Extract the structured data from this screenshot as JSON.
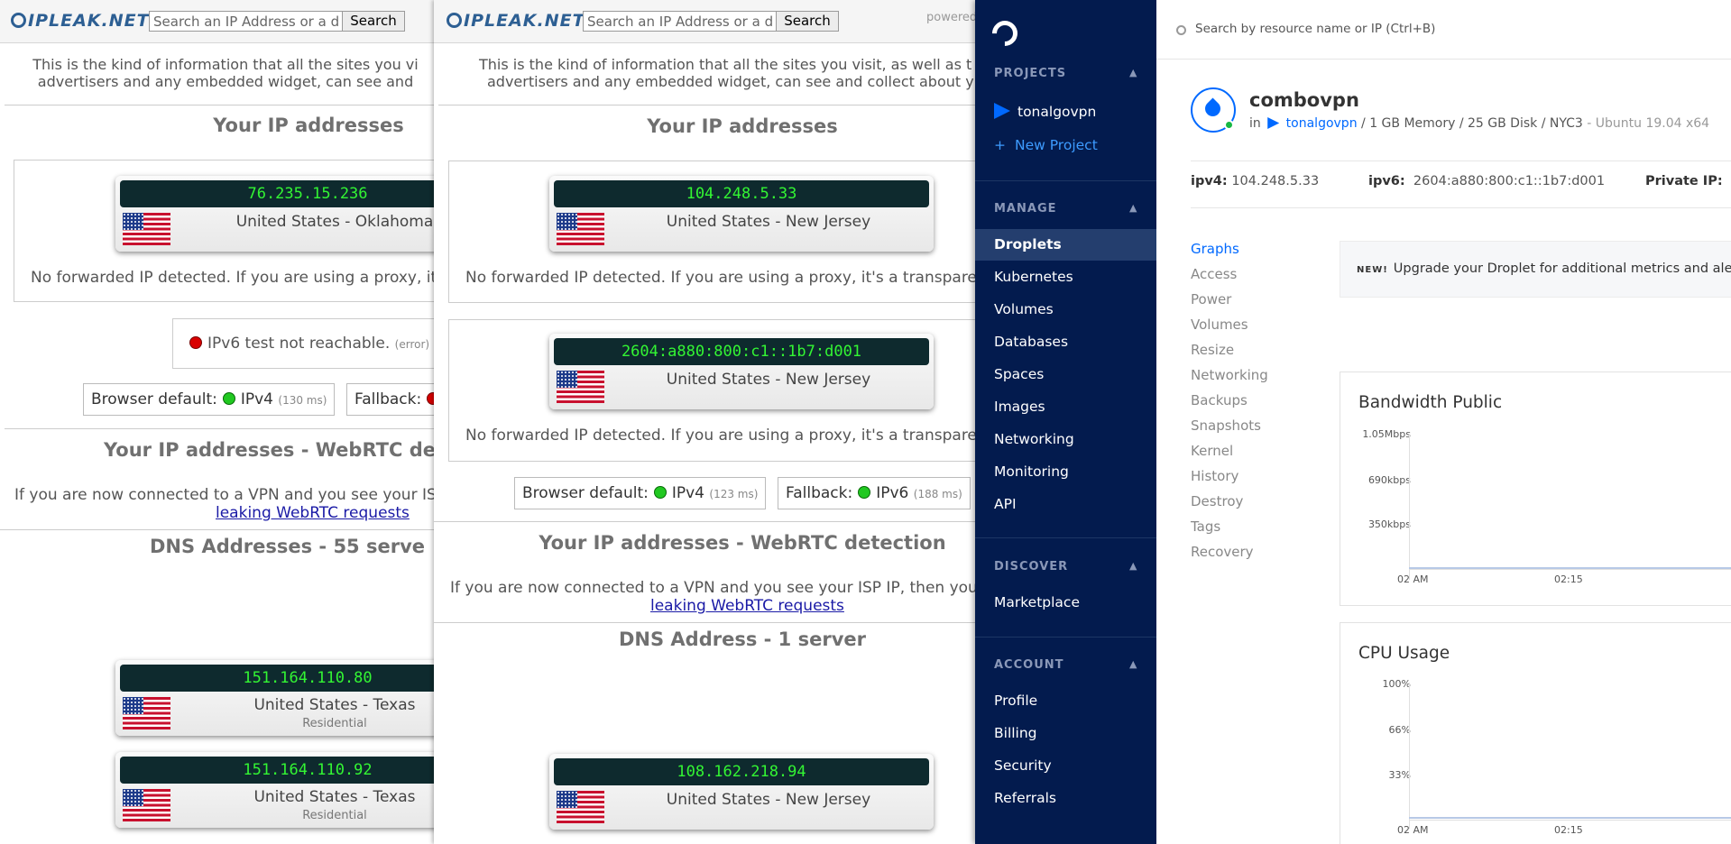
{
  "left_browser": {
    "logo": "IPLEAK.NET",
    "search_placeholder": "Search an IP Address or a d",
    "search_button": "Search",
    "intro_line1": "This is the kind of information that all the sites you vi",
    "intro_line2": "advertisers and any embedded widget, can see and",
    "ip_heading": "Your IP addresses",
    "ip_card": {
      "ip": "76.235.15.236",
      "location": "United States - Oklahoma"
    },
    "no_forward": "No forwarded IP detected. If you are using a proxy, it's",
    "ipv6_status": "IPv6 test not reachable.",
    "ipv6_error": "(error)",
    "browser_default_label": "Browser default:",
    "browser_default_proto": "IPv4",
    "browser_default_ms": "(130 ms)",
    "fallback_label": "Fallback:",
    "webrtc_heading": "Your IP addresses - WebRTC de",
    "webrtc_text": "If you are now connected to a VPN and you see your ISP",
    "webrtc_link": "leaking WebRTC requests",
    "dns_heading": "DNS Addresses - 55 serve",
    "dns_cards": [
      {
        "ip": "151.164.110.80",
        "location": "United States - Texas",
        "type": "Residential"
      },
      {
        "ip": "151.164.110.92",
        "location": "United States - Texas",
        "type": "Residential"
      }
    ]
  },
  "middle_browser": {
    "logo": "IPLEAK.NET",
    "search_placeholder": "Search an IP Address or a d",
    "search_button": "Search",
    "powered": "powered",
    "intro_line1": "This is the kind of information that all the sites you visit, as well as t",
    "intro_line2": "advertisers and any embedded widget, can see and collect about y",
    "ip_heading": "Your IP addresses",
    "ipv4_card": {
      "ip": "104.248.5.33",
      "location": "United States - New Jersey"
    },
    "no_forward_1": "No forwarded IP detected. If you are using a proxy, it's a transparent",
    "ipv6_card": {
      "ip": "2604:a880:800:c1::1b7:d001",
      "location": "United States - New Jersey"
    },
    "no_forward_2": "No forwarded IP detected. If you are using a proxy, it's a transparent",
    "browser_default_label": "Browser default:",
    "browser_default_proto": "IPv4",
    "browser_default_ms": "(123 ms)",
    "fallback_label": "Fallback:",
    "fallback_proto": "IPv6",
    "fallback_ms": "(188 ms)",
    "webrtc_heading": "Your IP addresses - WebRTC detection",
    "webrtc_text": "If you are now connected to a VPN and you see your ISP IP, then your sy",
    "webrtc_link": "leaking WebRTC requests",
    "dns_heading": "DNS Address - 1 server",
    "dns_card": {
      "ip": "108.162.218.94",
      "location": "United States - New Jersey"
    }
  },
  "digitalocean": {
    "nav": {
      "projects_label": "PROJECTS",
      "project_name": "tonalgovpn",
      "new_project": "New Project",
      "manage_label": "MANAGE",
      "manage_items": [
        "Droplets",
        "Kubernetes",
        "Volumes",
        "Databases",
        "Spaces",
        "Images",
        "Networking",
        "Monitoring",
        "API"
      ],
      "discover_label": "DISCOVER",
      "discover_items": [
        "Marketplace"
      ],
      "account_label": "ACCOUNT",
      "account_items": [
        "Profile",
        "Billing",
        "Security",
        "Referrals"
      ]
    },
    "search_placeholder": "Search by resource name or IP (Ctrl+B)",
    "droplet": {
      "name": "combovpn",
      "in": "in",
      "project": "tonalgovpn",
      "specs": "/ 1 GB Memory / 25 GB Disk / NYC3",
      "os": "- Ubuntu 19.04 x64",
      "ipv4_label": "ipv4:",
      "ipv4": "104.248.5.33",
      "ipv6_label": "ipv6:",
      "ipv6": "2604:a880:800:c1::1b7:d001",
      "private_label": "Private IP:"
    },
    "tabs": [
      "Graphs",
      "Access",
      "Power",
      "Volumes",
      "Resize",
      "Networking",
      "Backups",
      "Snapshots",
      "Kernel",
      "History",
      "Destroy",
      "Tags",
      "Recovery"
    ],
    "new_badge": "NEW!",
    "new_text": "Upgrade your Droplet for additional metrics and ale",
    "bandwidth": {
      "title": "Bandwidth Public",
      "yticks": [
        "1.05Mbps",
        "690kbps",
        "350kbps"
      ],
      "xticks": [
        "02 AM",
        "02:15"
      ]
    },
    "cpu": {
      "title": "CPU Usage",
      "yticks": [
        "100%",
        "66%",
        "33%"
      ],
      "xticks": [
        "02 AM",
        "02:15"
      ]
    }
  }
}
